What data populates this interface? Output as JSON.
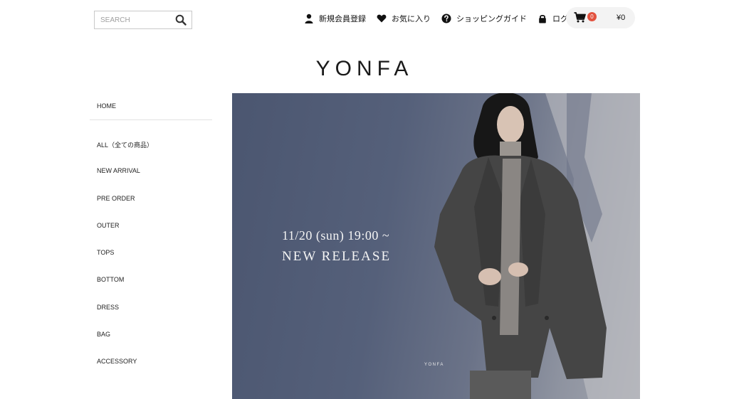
{
  "search": {
    "placeholder": "SEARCH",
    "icon": "search-icon"
  },
  "util_nav": {
    "register": {
      "label": "新規会員登録",
      "icon": "user-icon"
    },
    "favorites": {
      "label": "お気に入り",
      "icon": "heart-icon"
    },
    "guide": {
      "label": "ショッピングガイド",
      "icon": "question-icon"
    },
    "login": {
      "label": "ログイン",
      "icon": "lock-icon"
    }
  },
  "cart": {
    "count": "0",
    "total": "¥0",
    "icon": "cart-icon",
    "badge_color": "#e2523f"
  },
  "brand": {
    "logo": "YONFA"
  },
  "sidebar": {
    "home": "HOME",
    "items": [
      {
        "label": "ALL（全ての商品）"
      },
      {
        "label": "NEW ARRIVAL"
      },
      {
        "label": "PRE ORDER"
      },
      {
        "label": "OUTER"
      },
      {
        "label": "TOPS"
      },
      {
        "label": "BOTTOM"
      },
      {
        "label": "DRESS"
      },
      {
        "label": "BAG"
      },
      {
        "label": "ACCESSORY"
      }
    ]
  },
  "hero": {
    "date_line": "11/20 (sun) 19:00 ~",
    "headline": "NEW RELEASE",
    "watermark": "YONFA"
  }
}
